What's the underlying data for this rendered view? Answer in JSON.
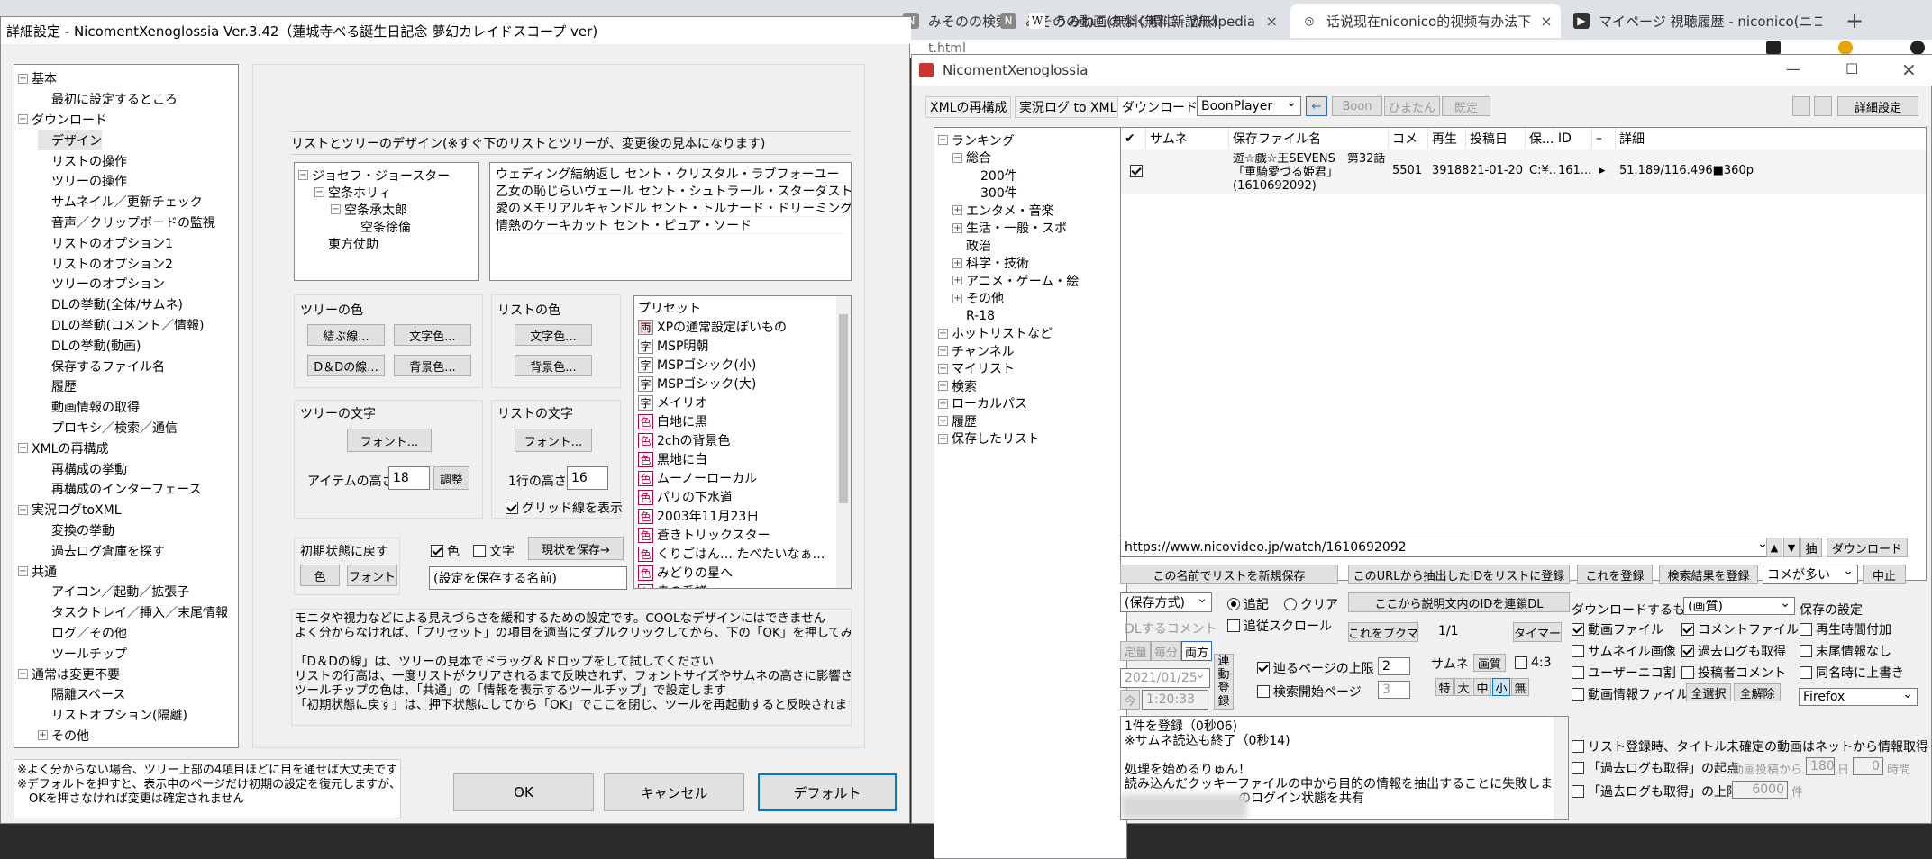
{
  "browser": {
    "tabs": [
      {
        "label": "みそのの検索結果 - 无料动画配信",
        "close": "×",
        "icon": "N"
      },
      {
        "label": "みそのの動画(無料(無料新話無料)",
        "close": "×",
        "icon": "N"
      },
      {
        "label": "うみねこのなく頃に - Wikipedia",
        "close": "×",
        "icon": "W"
      },
      {
        "label": "话说现在niconico的视频有办法下",
        "close": "×",
        "icon": "◎"
      },
      {
        "label": "マイページ 視聴履歴 - niconico(ニコ",
        "close": "×",
        "icon": "▶"
      }
    ],
    "new_tab": "+",
    "address": "t.html"
  },
  "settings": {
    "title": "詳細設定 - NicomentXenoglossia Ver.3.42（蓮城寺べる誕生日記念 夢幻カレイドスコープ ver)",
    "tree": [
      {
        "label": "基本",
        "level": 0,
        "exp": "−"
      },
      {
        "label": "最初に設定するところ",
        "level": 1
      },
      {
        "label": "ダウンロード",
        "level": 0,
        "exp": "−"
      },
      {
        "label": "デザイン",
        "level": 1,
        "sel": true
      },
      {
        "label": "リストの操作",
        "level": 1
      },
      {
        "label": "ツリーの操作",
        "level": 1
      },
      {
        "label": "サムネイル／更新チェック",
        "level": 1
      },
      {
        "label": "音声／クリップボードの監視",
        "level": 1
      },
      {
        "label": "リストのオプション1",
        "level": 1
      },
      {
        "label": "リストのオプション2",
        "level": 1
      },
      {
        "label": "ツリーのオプション",
        "level": 1
      },
      {
        "label": "DLの挙動(全体/サムネ)",
        "level": 1
      },
      {
        "label": "DLの挙動(コメント／情報)",
        "level": 1
      },
      {
        "label": "DLの挙動(動画)",
        "level": 1
      },
      {
        "label": "保存するファイル名",
        "level": 1
      },
      {
        "label": "履歴",
        "level": 1
      },
      {
        "label": "動画情報の取得",
        "level": 1
      },
      {
        "label": "プロキシ／検索／通信",
        "level": 1
      },
      {
        "label": "XMLの再構成",
        "level": 0,
        "exp": "−"
      },
      {
        "label": "再構成の挙動",
        "level": 1
      },
      {
        "label": "再構成のインターフェース",
        "level": 1
      },
      {
        "label": "実況ログtoXML",
        "level": 0,
        "exp": "−"
      },
      {
        "label": "変換の挙動",
        "level": 1
      },
      {
        "label": "過去ログ倉庫を探す",
        "level": 1
      },
      {
        "label": "共通",
        "level": 0,
        "exp": "−"
      },
      {
        "label": "アイコン／起動／拡張子",
        "level": 1
      },
      {
        "label": "タスクトレイ／挿入／末尾情報",
        "level": 1
      },
      {
        "label": "ログ／その他",
        "level": 1
      },
      {
        "label": "ツールチップ",
        "level": 1
      },
      {
        "label": "通常は変更不要",
        "level": 0,
        "exp": "−"
      },
      {
        "label": "隔離スペース",
        "level": 1
      },
      {
        "label": "リストオプション(隔離)",
        "level": 1
      },
      {
        "label": "その他",
        "level": 1,
        "exp": "+"
      }
    ],
    "heading": "リストとツリーのデザイン(※すぐ下のリストとツリーが、変更後の見本になります)",
    "sample_tree": [
      {
        "label": "ジョセフ・ジョースター",
        "level": 0,
        "exp": "−"
      },
      {
        "label": "空条ホリィ",
        "level": 1,
        "exp": "−"
      },
      {
        "label": "空条承太郎",
        "level": 2,
        "exp": "−"
      },
      {
        "label": "空条徐倫",
        "level": 3
      },
      {
        "label": "東方仗助",
        "level": 1
      }
    ],
    "sample_list": [
      "ウェディング結納返し セント・クリスタル・ラブフォーユー",
      "乙女の恥じらいヴェール セント・シュトラール・スターダスト",
      "愛のメモリアルキャンドル セント・トルナード・ドリーミング",
      "情熱のケーキカット セント・ピュア・ソード"
    ],
    "tree_color": {
      "label": "ツリーの色",
      "line": "結ぶ線...",
      "text": "文字色...",
      "dd_line": "D＆Dの線...",
      "bg": "背景色..."
    },
    "list_color": {
      "label": "リストの色",
      "text": "文字色...",
      "bg": "背景色..."
    },
    "tree_font": {
      "label": "ツリーの文字",
      "font": "フォント...",
      "item_height_label": "アイテムの高さ",
      "item_height": "18",
      "adjust": "調整"
    },
    "list_font": {
      "label": "リストの文字",
      "font": "フォント...",
      "row_height_label": "1行の高さ",
      "row_height": "16",
      "grid_label": "グリッド線を表示"
    },
    "reset": {
      "label": "初期状態に戻す",
      "color": "色",
      "font": "フォント"
    },
    "save_opts": {
      "color": "色",
      "text": "文字",
      "save_btn": "現状を保存→",
      "name_placeholder": "(設定を保存する名前)"
    },
    "presets": {
      "title": "プリセット",
      "items": [
        {
          "tag": "両",
          "text": "XPの通常設定ぽいもの"
        },
        {
          "tag": "字",
          "text": "MSP明朝"
        },
        {
          "tag": "字",
          "text": "MSPゴシック(小)"
        },
        {
          "tag": "字",
          "text": "MSPゴシック(大)"
        },
        {
          "tag": "字",
          "text": "メイリオ"
        },
        {
          "tag": "色",
          "text": "白地に黒"
        },
        {
          "tag": "色",
          "text": "2chの背景色"
        },
        {
          "tag": "色",
          "text": "黒地に白"
        },
        {
          "tag": "色",
          "text": "ムーノーローカル"
        },
        {
          "tag": "色",
          "text": "パリの下水道"
        },
        {
          "tag": "色",
          "text": "2003年11月23日"
        },
        {
          "tag": "色",
          "text": "蒼きトリックスター"
        },
        {
          "tag": "色",
          "text": "くりごはん… たべたいなぁ…"
        },
        {
          "tag": "色",
          "text": "みどりの星へ"
        },
        {
          "tag": "色",
          "text": "赤の系譜"
        }
      ]
    },
    "desc1": "モニタや視力などによる見えづらさを緩和するための設定です。COOLなデザインにはできません\nよく分からなければ、「プリセット」の項目を適当にダブルクリックしてから、下の「OK」を押してみてください\n\n「D＆Dの線」は、ツリーの見本でドラッグ＆ドロップをして試してください\nリストの行高は、一度リストがクリアされるまで反映されず、フォントサイズやサムネの高さに影響されます\nツールチップの色は、「共通」の「情報を表示するツールチップ」で設定します\n「初期状態に戻す」は、押下状態にしてから「OK」でここを閉じ、ツールを再起動すると反映されます",
    "footnote": "※よく分からない場合、ツリー上部の4項目ほどに目を通せば大丈夫です\n※デフォルトを押すと、表示中のページだけ初期の設定を復元しますが、\n　OKを押さなければ変更は確定されません",
    "ok": "OK",
    "cancel": "キャンセル",
    "default": "デフォルト"
  },
  "main": {
    "title": "NicomentXenoglossia",
    "controls": {
      "min": "—",
      "max": "☐",
      "close": "×"
    },
    "tabs": [
      "XMLの再構成",
      "実況ログ to XML",
      "ダウンロード"
    ],
    "player": "BoonPlayer",
    "arrow": "←",
    "tool_btns": [
      "Boon",
      "ひまたん",
      "既定"
    ],
    "detail_btn": "詳細設定",
    "side_tree": [
      {
        "label": "ランキング",
        "level": 0,
        "exp": "−"
      },
      {
        "label": "総合",
        "level": 1,
        "exp": "−"
      },
      {
        "label": "200件",
        "level": 2
      },
      {
        "label": "300件",
        "level": 2
      },
      {
        "label": "エンタメ・音楽",
        "level": 1,
        "exp": "+"
      },
      {
        "label": "生活・一般・スポ",
        "level": 1,
        "exp": "+"
      },
      {
        "label": "政治",
        "level": 1
      },
      {
        "label": "科学・技術",
        "level": 1,
        "exp": "+"
      },
      {
        "label": "アニメ・ゲーム・絵",
        "level": 1,
        "exp": "+"
      },
      {
        "label": "その他",
        "level": 1,
        "exp": "+"
      },
      {
        "label": "R-18",
        "level": 1
      },
      {
        "label": "ホットリストなど",
        "level": 0,
        "exp": "+"
      },
      {
        "label": "チャンネル",
        "level": 0,
        "exp": "+"
      },
      {
        "label": "マイリスト",
        "level": 0,
        "exp": "+"
      },
      {
        "label": "検索",
        "level": 0,
        "exp": "+"
      },
      {
        "label": "ローカルパス",
        "level": 0,
        "exp": "+"
      },
      {
        "label": "履歴",
        "level": 0,
        "exp": "+"
      },
      {
        "label": "保存したリスト",
        "level": 0,
        "exp": "+"
      }
    ],
    "grid_headers": [
      "✔",
      "サムネ",
      "保存ファイル名",
      "コメ",
      "再生",
      "投稿日",
      "保...",
      "ID",
      "–",
      "詳細"
    ],
    "rows": [
      {
        "title": "遊☆戯☆王SEVENS　第32話「重騎愛づる姫君」(1610692092)",
        "comments": "5501",
        "views": "39188",
        "date": "21-01-20",
        "saved": "C:¥...",
        "id": "161...",
        "play": "▸",
        "detail": "51.189/116.496■360p"
      }
    ],
    "url": "https://www.nicovideo.jp/watch/1610692092",
    "nav": {
      "up": "▲",
      "down": "▼",
      "extract": "抽",
      "download": "ダウンロード"
    },
    "buttons": {
      "save_list": "この名前でリストを新規保存",
      "register_ids": "このURLから抽出したIDをリストに登録",
      "register": "これを登録",
      "register_search": "検索結果を登録",
      "sort": "コメが多い",
      "stop": "中止",
      "dl_desc": "ここから説明文内のIDを連鎖DL",
      "bookmark": "これをブクマ",
      "page": "1/1",
      "timer": "タイマー"
    },
    "save_mode": "(保存方式)",
    "append": "追記",
    "clear": "クリア",
    "append_scroll": "追従スクロール",
    "dl_comment": "DLするコメント",
    "fixed": "定量",
    "per_min": "毎分",
    "both": "両方",
    "date": "2021/01/25",
    "now": "今",
    "time": "1:20:33",
    "chain": "連動登録",
    "page_limit_label": "辿るページの上限",
    "page_limit": "2",
    "search_start_label": "検索開始ページ",
    "search_start": "3",
    "thumb": "サムネ",
    "image": "画質",
    "ratio": "4:3",
    "sizes": [
      "特",
      "大",
      "中",
      "小",
      "無"
    ],
    "dl_what": "ダウンロードするもの",
    "quality": "(画質)",
    "opt_video": "動画ファイル",
    "opt_comment": "コメントファイル",
    "opt_thumb": "サムネイル画像",
    "opt_past": "過去ログも取得",
    "opt_user": "ユーザーニコ割",
    "opt_poster": "投稿者コメント",
    "opt_info": "動画情報ファイル",
    "select_all": "全選択",
    "deselect_all": "全解除",
    "save_settings": "保存の設定",
    "opt_playtime": "再生時間付加",
    "opt_tail": "末尾情報なし",
    "opt_overwrite": "同名時に上書き",
    "browser_sel": "Firefox",
    "log": "1件を登録（0秒06)\n※サムネ読込も終了（0秒14)\n\n処理を始めるりゅん！\n読み込んだクッキーファイルの中から目的の情報を抽出することに失敗しました\n　　　　　　　　　のログイン状態を共有",
    "opt_fetch": "リスト登録時、タイトル未確定の動画はネットから情報取得",
    "opt_past_start": "「過去ログも取得」の起点",
    "from_post": "動画投稿から",
    "days": "180",
    "day_unit": "日",
    "hours": "0",
    "hour_unit": "時間",
    "opt_past_limit": "「過去ログも取得」の上限",
    "limit": "6000",
    "limit_unit": "件"
  }
}
